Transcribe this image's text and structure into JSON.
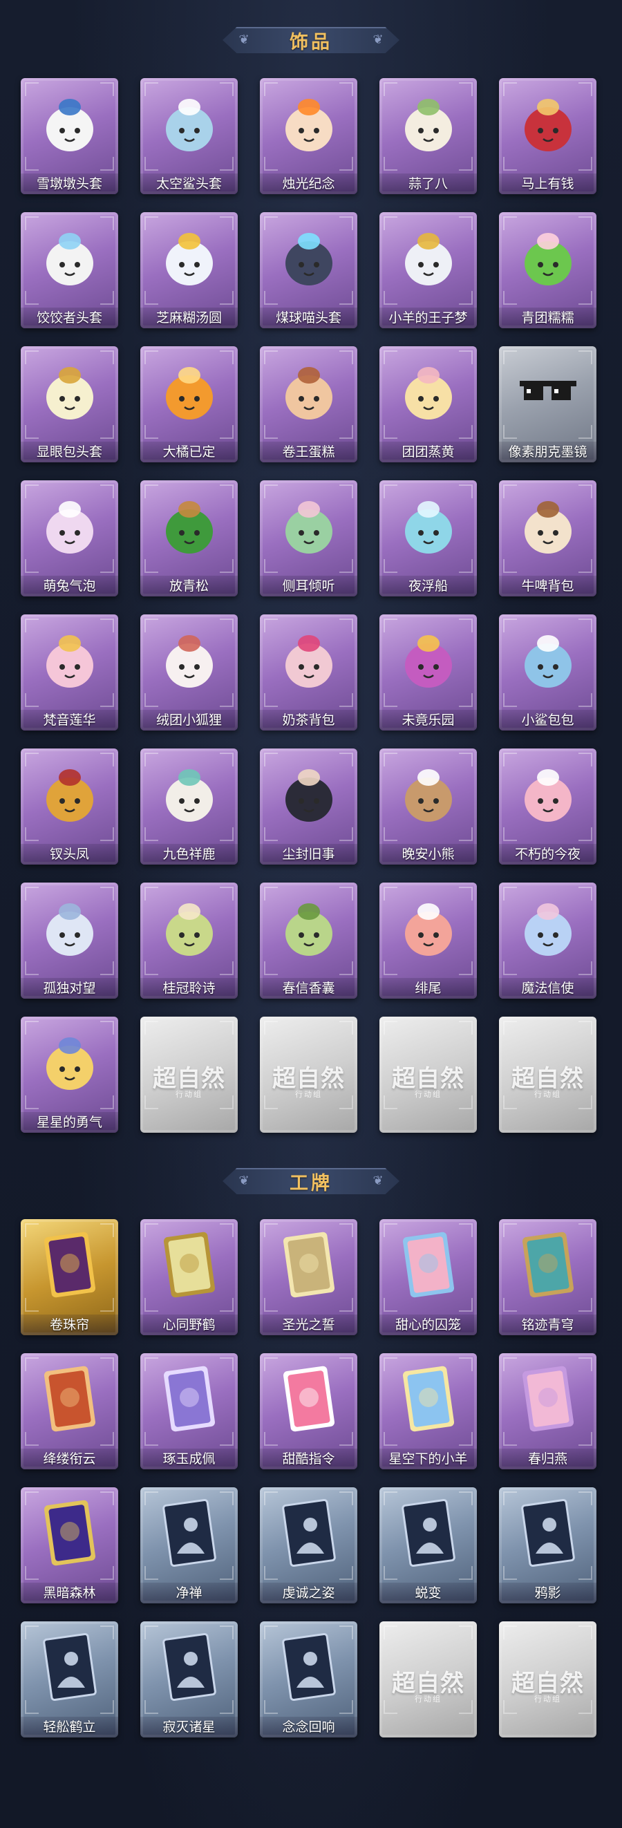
{
  "accessories": {
    "title": "饰品",
    "items": [
      {
        "label": "雪墩墩头套",
        "style": "purple",
        "icon": "snowman-hood-icon",
        "color": "#f5f5f5",
        "accent": "#3a78c8"
      },
      {
        "label": "太空鲨头套",
        "style": "purple",
        "icon": "shark-hood-icon",
        "color": "#a9d2ea",
        "accent": "#ffffff"
      },
      {
        "label": "烛光纪念",
        "style": "purple",
        "icon": "candle-head-icon",
        "color": "#f7dcc4",
        "accent": "#ff8a2a"
      },
      {
        "label": "蒜了八",
        "style": "purple",
        "icon": "garlic-head-icon",
        "color": "#f4ede0",
        "accent": "#8fbf6a"
      },
      {
        "label": "马上有钱",
        "style": "purple",
        "icon": "horse-head-icon",
        "color": "#c8323c",
        "accent": "#f3c86a"
      },
      {
        "label": "饺饺者头套",
        "style": "purple",
        "icon": "dumpling-hood-icon",
        "color": "#f3f3f3",
        "accent": "#8fd3f5"
      },
      {
        "label": "芝麻糊汤圆",
        "style": "purple",
        "icon": "tangyuan-icon",
        "color": "#f0f3fb",
        "accent": "#f3c23a"
      },
      {
        "label": "煤球喵头套",
        "style": "purple",
        "icon": "black-cat-hood-icon",
        "color": "#3f4660",
        "accent": "#7ee0ff"
      },
      {
        "label": "小羊的王子梦",
        "style": "purple",
        "icon": "sheep-crown-icon",
        "color": "#eef0f6",
        "accent": "#e6b73d"
      },
      {
        "label": "青团糯糯",
        "style": "purple",
        "icon": "green-rice-ball-icon",
        "color": "#6cc74e",
        "accent": "#ffd0dd"
      },
      {
        "label": "显眼包头套",
        "style": "purple",
        "icon": "bun-crown-icon",
        "color": "#f6f0cf",
        "accent": "#d9a53a"
      },
      {
        "label": "大橘已定",
        "style": "purple",
        "icon": "orange-slice-icon",
        "color": "#f39a2e",
        "accent": "#ffd985"
      },
      {
        "label": "卷王蛋糕",
        "style": "purple",
        "icon": "roll-cake-icon",
        "color": "#f0c6a0",
        "accent": "#b0623a"
      },
      {
        "label": "团团蒸黄",
        "style": "purple",
        "icon": "steamed-bun-icon",
        "color": "#f7e0a6",
        "accent": "#f4b8c2"
      },
      {
        "label": "像素朋克墨镜",
        "style": "grey",
        "icon": "pixel-sunglasses-icon",
        "color": "#1a1a1a",
        "accent": "#9aa1ad"
      },
      {
        "label": "萌兔气泡",
        "style": "purple",
        "icon": "bunny-bubble-icon",
        "color": "#efd8f0",
        "accent": "#ffffff"
      },
      {
        "label": "放青松",
        "style": "purple",
        "icon": "potted-pine-icon",
        "color": "#3f9a3c",
        "accent": "#c58a3e"
      },
      {
        "label": "侧耳倾听",
        "style": "purple",
        "icon": "floral-ear-icon",
        "color": "#9ad0a2",
        "accent": "#f3c7d6"
      },
      {
        "label": "夜浮船",
        "style": "purple",
        "icon": "jellyfish-icon",
        "color": "#8fd6e8",
        "accent": "#e3f7ff"
      },
      {
        "label": "牛啤背包",
        "style": "purple",
        "icon": "cow-beer-bag-icon",
        "color": "#f3e2cc",
        "accent": "#a06436"
      },
      {
        "label": "梵音莲华",
        "style": "purple",
        "icon": "lotus-figure-icon",
        "color": "#f5c6d8",
        "accent": "#f2c250"
      },
      {
        "label": "绒团小狐狸",
        "style": "purple",
        "icon": "fox-charm-icon",
        "color": "#f7f0f0",
        "accent": "#d0665a"
      },
      {
        "label": "奶茶背包",
        "style": "purple",
        "icon": "milk-tea-bag-icon",
        "color": "#f1c9d3",
        "accent": "#e0467a"
      },
      {
        "label": "未竟乐园",
        "style": "purple",
        "icon": "jester-figure-icon",
        "color": "#c45cc0",
        "accent": "#f6c24c"
      },
      {
        "label": "小鲨包包",
        "style": "purple",
        "icon": "shark-bag-icon",
        "color": "#8fc4e8",
        "accent": "#ffffff"
      },
      {
        "label": "钗头凤",
        "style": "purple",
        "icon": "phoenix-crown-figure-icon",
        "color": "#e0a33a",
        "accent": "#b2322c"
      },
      {
        "label": "九色祥鹿",
        "style": "purple",
        "icon": "deer-charm-icon",
        "color": "#f2eee8",
        "accent": "#6fc7b8"
      },
      {
        "label": "尘封旧事",
        "style": "purple",
        "icon": "gentleman-figure-icon",
        "color": "#2b2b38",
        "accent": "#f0d7c4"
      },
      {
        "label": "晚安小熊",
        "style": "purple",
        "icon": "bear-charm-icon",
        "color": "#c89a6c",
        "accent": "#ffffff"
      },
      {
        "label": "不朽的今夜",
        "style": "purple",
        "icon": "pink-cat-charm-icon",
        "color": "#f4b6c8",
        "accent": "#ffffff"
      },
      {
        "label": "孤独对望",
        "style": "purple",
        "icon": "twin-figure-icon",
        "color": "#dfe6f5",
        "accent": "#9cb6dd"
      },
      {
        "label": "桂冠聆诗",
        "style": "purple",
        "icon": "laurel-figure-icon",
        "color": "#c9d88a",
        "accent": "#f5e8c8"
      },
      {
        "label": "春信香囊",
        "style": "purple",
        "icon": "sachet-icon",
        "color": "#b9d58a",
        "accent": "#6a9a3f"
      },
      {
        "label": "绯尾",
        "style": "purple",
        "icon": "fox-girl-figure-icon",
        "color": "#f3a49a",
        "accent": "#ffffff"
      },
      {
        "label": "魔法信使",
        "style": "purple",
        "icon": "elephant-charm-icon",
        "color": "#b9d2f5",
        "accent": "#f1c6de"
      },
      {
        "label": "星星的勇气",
        "style": "purple",
        "icon": "star-planet-figure-icon",
        "color": "#f4d06a",
        "accent": "#6f87d8"
      },
      {
        "label": "",
        "style": "silver",
        "icon": "locked-placeholder-icon",
        "placeholder": "超自然",
        "placeholder_sub": "行动组"
      },
      {
        "label": "",
        "style": "silver",
        "icon": "locked-placeholder-icon",
        "placeholder": "超自然",
        "placeholder_sub": "行动组"
      },
      {
        "label": "",
        "style": "silver",
        "icon": "locked-placeholder-icon",
        "placeholder": "超自然",
        "placeholder_sub": "行动组"
      },
      {
        "label": "",
        "style": "silver",
        "icon": "locked-placeholder-icon",
        "placeholder": "超自然",
        "placeholder_sub": "行动组"
      }
    ]
  },
  "badges": {
    "title": "工牌",
    "items": [
      {
        "label": "卷珠帘",
        "style": "gold",
        "icon": "ornate-card-icon",
        "color": "#5a2a6a",
        "accent": "#f2c24a"
      },
      {
        "label": "心同野鹤",
        "style": "purple",
        "icon": "gold-frame-card-icon",
        "color": "#e7df9a",
        "accent": "#b79538"
      },
      {
        "label": "圣光之誓",
        "style": "purple",
        "icon": "holy-light-card-icon",
        "color": "#c9b37a",
        "accent": "#f3e6b0"
      },
      {
        "label": "甜心的囚笼",
        "style": "purple",
        "icon": "heart-cage-card-icon",
        "color": "#f3b2c8",
        "accent": "#8ec5ee"
      },
      {
        "label": "铭迹青穹",
        "style": "purple",
        "icon": "teal-sky-card-icon",
        "color": "#4da6a8",
        "accent": "#c8a35a"
      },
      {
        "label": "绛缕衔云",
        "style": "purple",
        "icon": "red-cloud-card-icon",
        "color": "#c8542e",
        "accent": "#f2c080"
      },
      {
        "label": "琢玉成佩",
        "style": "purple",
        "icon": "jade-card-icon",
        "color": "#8a76d4",
        "accent": "#e6dbff"
      },
      {
        "label": "甜酷指令",
        "style": "purple",
        "icon": "monster-mouth-card-icon",
        "color": "#f37aa0",
        "accent": "#ffffff"
      },
      {
        "label": "星空下的小羊",
        "style": "purple",
        "icon": "starry-sheep-card-icon",
        "color": "#8cc4f0",
        "accent": "#f6e7a2"
      },
      {
        "label": "春归燕",
        "style": "purple",
        "icon": "spring-swallow-card-icon",
        "color": "#f2b9d6",
        "accent": "#c59ae0"
      },
      {
        "label": "黑暗森林",
        "style": "purple",
        "icon": "galaxy-card-icon",
        "color": "#3d2a8a",
        "accent": "#e3c45a"
      },
      {
        "label": "净禅",
        "style": "steel",
        "icon": "silhouette-card-icon",
        "color": "#1f2b44",
        "accent": "#c9d6ea"
      },
      {
        "label": "虔诚之姿",
        "style": "steel",
        "icon": "silhouette-card-icon",
        "color": "#1f2b44",
        "accent": "#c9d6ea"
      },
      {
        "label": "蜕变",
        "style": "steel",
        "icon": "silhouette-card-icon",
        "color": "#1f2b44",
        "accent": "#c9d6ea"
      },
      {
        "label": "鸦影",
        "style": "steel",
        "icon": "silhouette-card-icon",
        "color": "#1f2b44",
        "accent": "#c9d6ea"
      },
      {
        "label": "轻舩鹤立",
        "style": "steel",
        "icon": "silhouette-card-icon",
        "color": "#1f2b44",
        "accent": "#c9d6ea"
      },
      {
        "label": "寂灭诸星",
        "style": "steel",
        "icon": "silhouette-card-icon",
        "color": "#1f2b44",
        "accent": "#c9d6ea"
      },
      {
        "label": "念念回响",
        "style": "steel",
        "icon": "silhouette-card-icon",
        "color": "#1f2b44",
        "accent": "#c9d6ea"
      },
      {
        "label": "",
        "style": "silver",
        "icon": "locked-placeholder-icon",
        "placeholder": "超自然",
        "placeholder_sub": "行动组"
      },
      {
        "label": "",
        "style": "silver",
        "icon": "locked-placeholder-icon",
        "placeholder": "超自然",
        "placeholder_sub": "行动组"
      }
    ]
  }
}
